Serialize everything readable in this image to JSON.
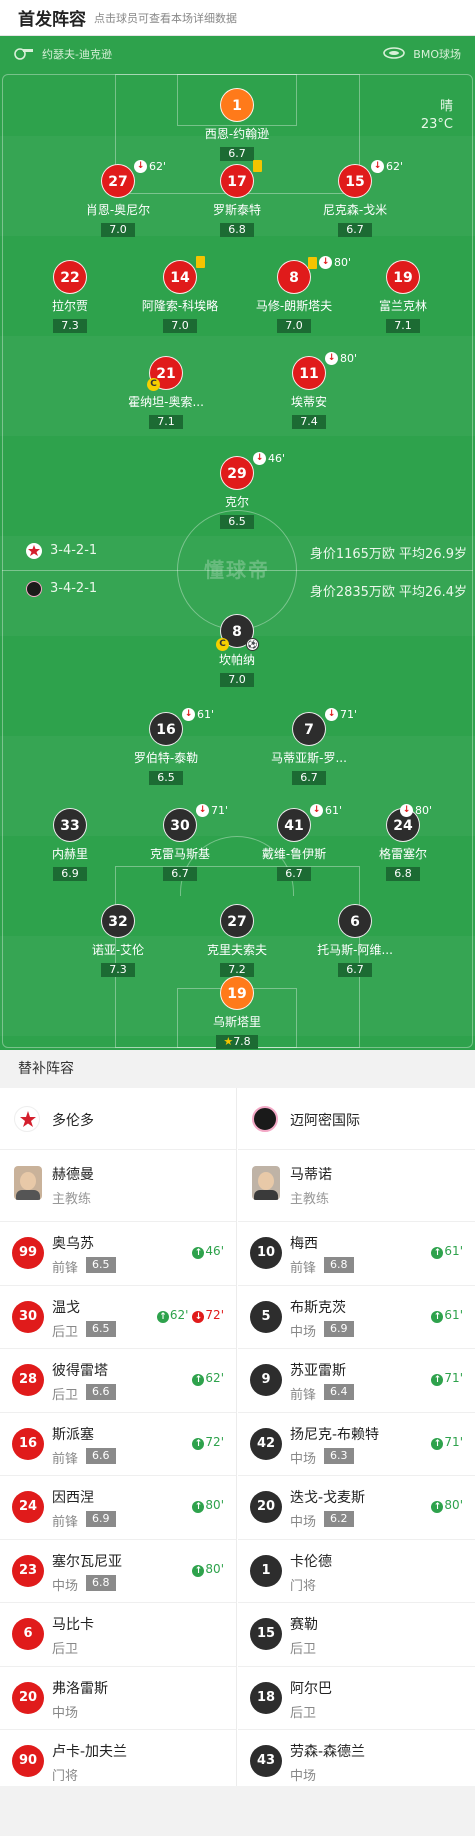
{
  "header": {
    "title": "首发阵容",
    "subtitle": "点击球员可查看本场详细数据"
  },
  "pitch": {
    "referee": "约瑟夫-迪克逊",
    "venue": "BMO球场",
    "weather": "晴",
    "temperature": "23°C",
    "watermark": "懂球帝",
    "home_formation": "3-4-2-1",
    "home_value": "身价1165万欧 平均26.9岁",
    "away_formation": "3-4-2-1",
    "away_value": "身价2835万欧 平均26.4岁"
  },
  "home": [
    {
      "num": "1",
      "name": "西恩-约翰逊",
      "rating": "6.7",
      "color": "orange"
    },
    {
      "num": "27",
      "name": "肖恩-奥尼尔",
      "rating": "7.0",
      "color": "red",
      "event": "62'"
    },
    {
      "num": "17",
      "name": "罗斯泰特",
      "rating": "6.8",
      "color": "red"
    },
    {
      "num": "15",
      "name": "尼克森-戈米",
      "rating": "6.7",
      "color": "red",
      "event": "62'"
    },
    {
      "num": "22",
      "name": "拉尔贾",
      "rating": "7.3",
      "color": "red"
    },
    {
      "num": "14",
      "name": "阿隆索-科埃略",
      "rating": "7.0",
      "color": "red"
    },
    {
      "num": "8",
      "name": "马修-朗斯塔夫",
      "rating": "7.0",
      "color": "red",
      "event": "80'"
    },
    {
      "num": "19",
      "name": "富兰克林",
      "rating": "7.1",
      "color": "red"
    },
    {
      "num": "21",
      "name": "霍纳坦-奥索...",
      "rating": "7.1",
      "color": "red"
    },
    {
      "num": "11",
      "name": "埃蒂安",
      "rating": "7.4",
      "color": "red",
      "event": "80'"
    },
    {
      "num": "29",
      "name": "克尔",
      "rating": "6.5",
      "color": "red",
      "event": "46'"
    }
  ],
  "away": [
    {
      "num": "8",
      "name": "坎帕纳",
      "rating": "7.0",
      "color": "dark"
    },
    {
      "num": "16",
      "name": "罗伯特-泰勒",
      "rating": "6.5",
      "color": "dark",
      "event": "61'"
    },
    {
      "num": "7",
      "name": "马蒂亚斯-罗...",
      "rating": "6.7",
      "color": "dark",
      "event": "71'"
    },
    {
      "num": "33",
      "name": "内赫里",
      "rating": "6.9",
      "color": "dark"
    },
    {
      "num": "30",
      "name": "克雷马斯基",
      "rating": "6.7",
      "color": "dark",
      "event": "71'"
    },
    {
      "num": "41",
      "name": "戴维-鲁伊斯",
      "rating": "6.7",
      "color": "dark",
      "event": "61'"
    },
    {
      "num": "24",
      "name": "格雷塞尔",
      "rating": "6.8",
      "color": "dark",
      "event": "80'"
    },
    {
      "num": "32",
      "name": "诺亚-艾伦",
      "rating": "7.3",
      "color": "dark"
    },
    {
      "num": "27",
      "name": "克里夫索夫",
      "rating": "7.2",
      "color": "dark"
    },
    {
      "num": "6",
      "name": "托马斯-阿维...",
      "rating": "6.7",
      "color": "dark"
    },
    {
      "num": "19",
      "name": "乌斯塔里",
      "rating": "7.8",
      "color": "orange"
    }
  ],
  "bench": {
    "title": "替补阵容",
    "home_team": "多伦多",
    "away_team": "迈阿密国际",
    "home_coach": {
      "name": "赫德曼",
      "role": "主教练"
    },
    "away_coach": {
      "name": "马蒂诺",
      "role": "主教练"
    },
    "home_subs": [
      {
        "num": "99",
        "name": "奥乌苏",
        "pos": "前锋",
        "rating": "6.5",
        "in": "46'"
      },
      {
        "num": "30",
        "name": "温戈",
        "pos": "后卫",
        "rating": "6.5",
        "in": "62'",
        "out": "72'"
      },
      {
        "num": "28",
        "name": "彼得雷塔",
        "pos": "后卫",
        "rating": "6.6",
        "in": "62'"
      },
      {
        "num": "16",
        "name": "斯派塞",
        "pos": "前锋",
        "rating": "6.6",
        "in": "72'"
      },
      {
        "num": "24",
        "name": "因西涅",
        "pos": "前锋",
        "rating": "6.9",
        "in": "80'"
      },
      {
        "num": "23",
        "name": "塞尔瓦尼亚",
        "pos": "中场",
        "rating": "6.8",
        "in": "80'"
      },
      {
        "num": "6",
        "name": "马比卡",
        "pos": "后卫"
      },
      {
        "num": "20",
        "name": "弗洛雷斯",
        "pos": "中场"
      },
      {
        "num": "90",
        "name": "卢卡-加夫兰",
        "pos": "门将"
      }
    ],
    "away_subs": [
      {
        "num": "10",
        "name": "梅西",
        "pos": "前锋",
        "rating": "6.8",
        "in": "61'"
      },
      {
        "num": "5",
        "name": "布斯克茨",
        "pos": "中场",
        "rating": "6.9",
        "in": "61'"
      },
      {
        "num": "9",
        "name": "苏亚雷斯",
        "pos": "前锋",
        "rating": "6.4",
        "in": "71'"
      },
      {
        "num": "42",
        "name": "扬尼克-布赖特",
        "pos": "中场",
        "rating": "6.3",
        "in": "71'"
      },
      {
        "num": "20",
        "name": "迭戈-戈麦斯",
        "pos": "中场",
        "rating": "6.2",
        "in": "80'"
      },
      {
        "num": "1",
        "name": "卡伦德",
        "pos": "门将"
      },
      {
        "num": "15",
        "name": "赛勒",
        "pos": "后卫"
      },
      {
        "num": "18",
        "name": "阿尔巴",
        "pos": "后卫"
      },
      {
        "num": "43",
        "name": "劳森-森德兰",
        "pos": "中场"
      }
    ]
  },
  "icons": {
    "whistle": "whistle-icon",
    "stadium": "stadium-icon",
    "sub_out": "sub-out-icon",
    "sub_in": "sub-in-icon",
    "yellow_card": "yellow-card-icon",
    "captain": "captain-icon",
    "goal": "football-icon"
  }
}
